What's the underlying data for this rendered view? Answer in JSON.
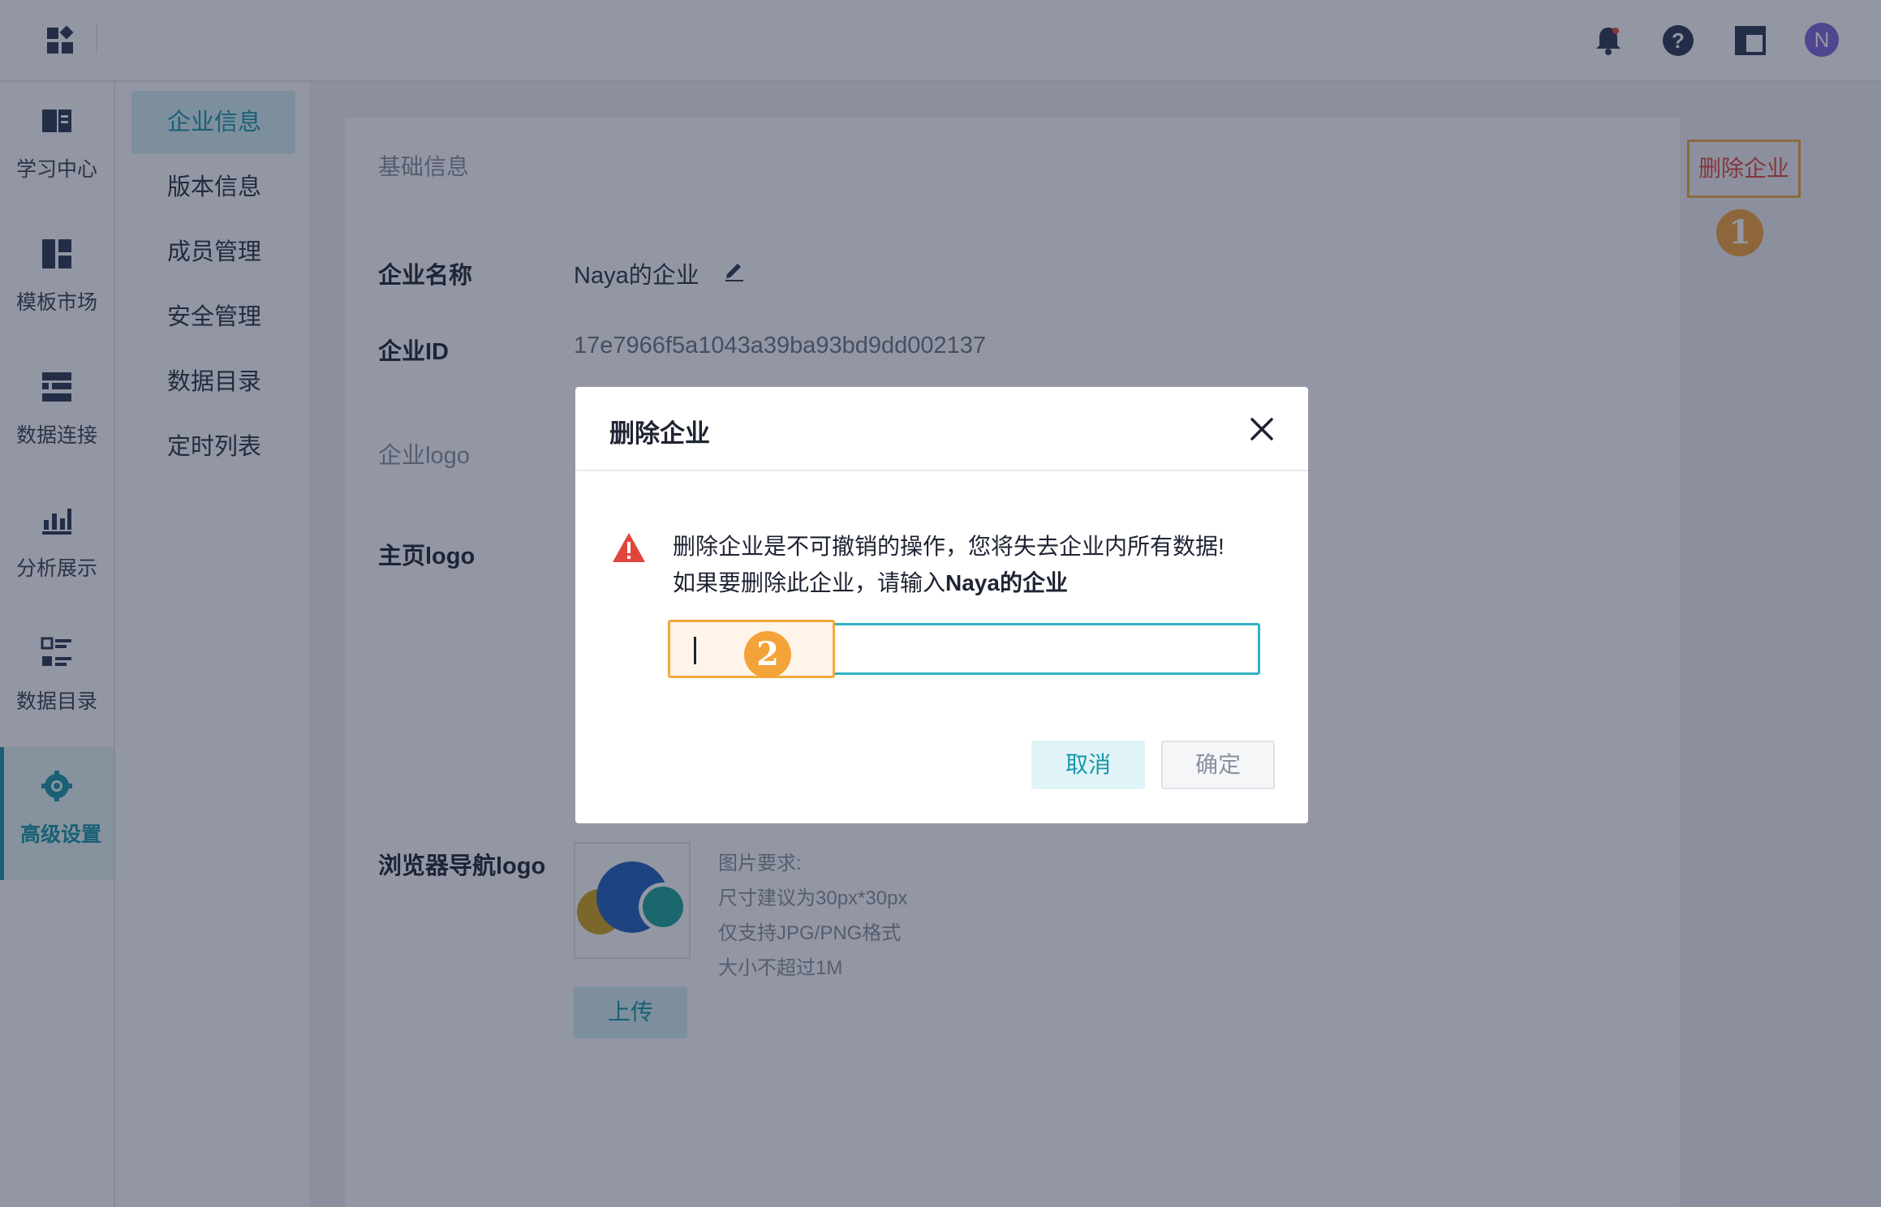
{
  "topbar": {
    "logo_icon": "apps-grid-icon",
    "icons": [
      "bell-icon",
      "help-icon",
      "layout-icon"
    ],
    "avatar_initial": "N"
  },
  "rail": {
    "items": [
      {
        "label": "学习中心",
        "icon": "book-icon"
      },
      {
        "label": "模板市场",
        "icon": "template-icon"
      },
      {
        "label": "数据连接",
        "icon": "connection-icon"
      },
      {
        "label": "分析展示",
        "icon": "chart-icon"
      },
      {
        "label": "数据目录",
        "icon": "catalog-icon"
      },
      {
        "label": "高级设置",
        "icon": "settings-gear-icon",
        "active": true
      }
    ]
  },
  "subnav": {
    "items": [
      "企业信息",
      "版本信息",
      "成员管理",
      "安全管理",
      "数据目录",
      "定时列表"
    ],
    "active": "企业信息"
  },
  "content": {
    "section_title": "基础信息",
    "delete_button": "删除企业",
    "step1": "1",
    "fields": {
      "name_label": "企业名称",
      "name_value": "Naya的企业",
      "id_label": "企业ID",
      "id_value": "17e7966f5a1043a39ba93bd9dd002137",
      "ent_logo_label": "企业logo",
      "home_logo_label": "主页logo",
      "browser_logo_label": "浏览器导航logo"
    },
    "requirements": [
      "图片要求:",
      "尺寸建议为30px*30px",
      "仅支持JPG/PNG格式",
      "大小不超过1M"
    ],
    "upload_button": "上传"
  },
  "dialog": {
    "title": "删除企业",
    "warning_line1": "删除企业是不可撤销的操作，您将失去企业内所有数据!",
    "warning_line2_prefix": "如果要删除此企业，请输入",
    "warning_line2_bold": "Naya的企业",
    "input_value": "",
    "step2": "2",
    "cancel_label": "取消",
    "ok_label": "确定"
  },
  "colors": {
    "accent": "#1696a8",
    "danger": "#e0463c",
    "annotation": "#f2a93b",
    "avatar": "#7f63d8"
  }
}
